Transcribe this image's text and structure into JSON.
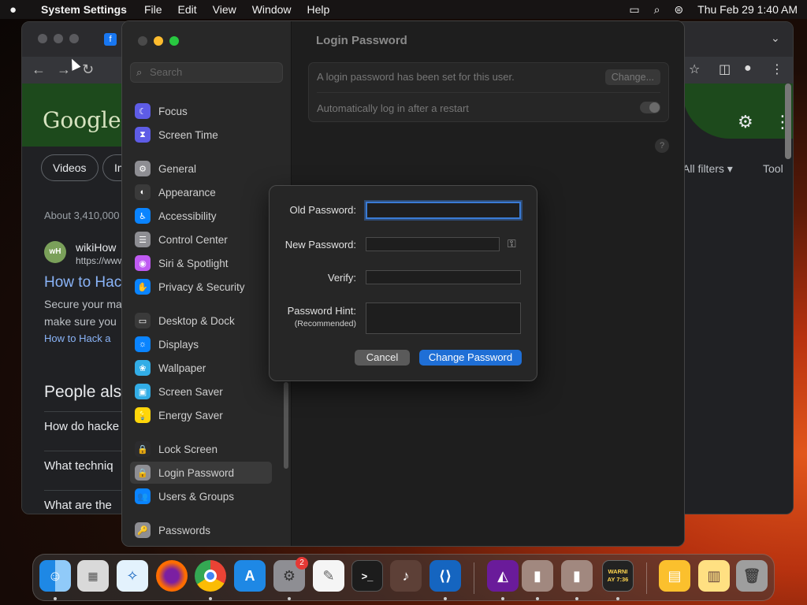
{
  "menubar": {
    "app_name": "System Settings",
    "menus": [
      "File",
      "Edit",
      "View",
      "Window",
      "Help"
    ],
    "datetime": "Thu Feb 29  1:40 AM"
  },
  "browser": {
    "logo": "Google",
    "tabs": [
      "Videos",
      "Im"
    ],
    "all_filters": "All filters",
    "tools": "Tool",
    "result_count": "About 3,410,000",
    "result": {
      "site_name": "wikiHow",
      "site_url": "https://www",
      "site_icon": "wH",
      "title": "How to Hack",
      "snippet_1": "Secure your ma",
      "snippet_2": "make sure you",
      "link": "How to Hack a"
    },
    "people_also": "People als",
    "questions": [
      "How do hacke",
      "What techniq",
      "What are the"
    ]
  },
  "settings": {
    "search_placeholder": "Search",
    "sidebar_items": [
      {
        "label": "Focus",
        "icon": "moon-icon",
        "color": "#5e5ce6",
        "glyph": "☾"
      },
      {
        "label": "Screen Time",
        "icon": "hourglass-icon",
        "color": "#5e5ce6",
        "glyph": "⧗"
      },
      {
        "label": "General",
        "icon": "gear-icon",
        "color": "#8e8e93",
        "glyph": "⚙"
      },
      {
        "label": "Appearance",
        "icon": "appearance-icon",
        "color": "#3a3a3a",
        "glyph": "◐"
      },
      {
        "label": "Accessibility",
        "icon": "accessibility-icon",
        "color": "#0a84ff",
        "glyph": "♿"
      },
      {
        "label": "Control Center",
        "icon": "control-center-icon",
        "color": "#8e8e93",
        "glyph": "☰"
      },
      {
        "label": "Siri & Spotlight",
        "icon": "siri-icon",
        "color": "#bf5af2",
        "glyph": "◉"
      },
      {
        "label": "Privacy & Security",
        "icon": "hand-icon",
        "color": "#0a84ff",
        "glyph": "✋"
      },
      {
        "label": "Desktop & Dock",
        "icon": "dock-icon",
        "color": "#3a3a3a",
        "glyph": "▭"
      },
      {
        "label": "Displays",
        "icon": "displays-icon",
        "color": "#0a84ff",
        "glyph": "☼"
      },
      {
        "label": "Wallpaper",
        "icon": "wallpaper-icon",
        "color": "#32ade6",
        "glyph": "❀"
      },
      {
        "label": "Screen Saver",
        "icon": "screen-saver-icon",
        "color": "#32ade6",
        "glyph": "▣"
      },
      {
        "label": "Energy Saver",
        "icon": "bulb-icon",
        "color": "#ffd60a",
        "glyph": "💡"
      },
      {
        "label": "Lock Screen",
        "icon": "lock-icon",
        "color": "#2c2c2e",
        "glyph": "🔒"
      },
      {
        "label": "Login Password",
        "icon": "login-lock-icon",
        "color": "#8e8e93",
        "glyph": "🔒"
      },
      {
        "label": "Users & Groups",
        "icon": "users-icon",
        "color": "#0a84ff",
        "glyph": "👥"
      },
      {
        "label": "Passwords",
        "icon": "key-icon",
        "color": "#8e8e93",
        "glyph": "🔑"
      }
    ],
    "selected_item": "Login Password",
    "detail": {
      "title": "Login Password",
      "status_text": "A login password has been set for this user.",
      "change_button": "Change...",
      "auto_login": "Automatically log in after a restart",
      "help": "?"
    }
  },
  "dialog": {
    "old_password_label": "Old Password:",
    "new_password_label": "New Password:",
    "verify_label": "Verify:",
    "hint_label": "Password Hint:",
    "hint_sublabel": "(Recommended)",
    "old_password_value": "",
    "new_password_value": "",
    "verify_value": "",
    "hint_value": "",
    "cancel": "Cancel",
    "submit": "Change Password"
  },
  "dock": {
    "settings_badge": "2",
    "console_text": "WARNI\nAY 7:36"
  }
}
